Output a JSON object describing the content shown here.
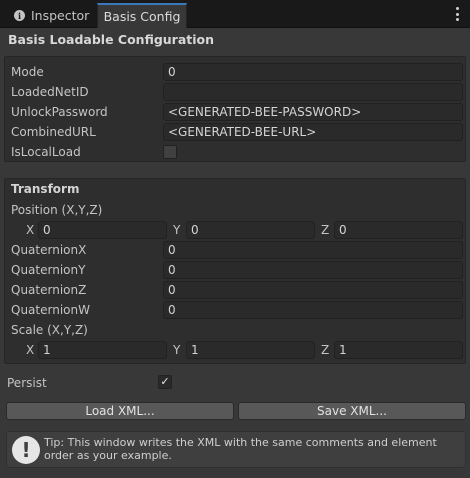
{
  "tabs": [
    {
      "label": "Inspector"
    },
    {
      "label": "Basis Config"
    }
  ],
  "header": {
    "title": "Basis Loadable Configuration"
  },
  "fields": {
    "mode": {
      "label": "Mode",
      "value": "0"
    },
    "loaded_net_id": {
      "label": "LoadedNetID",
      "value": ""
    },
    "unlock_password": {
      "label": "UnlockPassword",
      "value": "<GENERATED-BEE-PASSWORD>"
    },
    "combined_url": {
      "label": "CombinedURL",
      "value": "<GENERATED-BEE-URL>"
    },
    "is_local_load": {
      "label": "IsLocalLoad",
      "checked": false
    }
  },
  "transform": {
    "title": "Transform",
    "position": {
      "label": "Position (X,Y,Z)",
      "x": "0",
      "y": "0",
      "z": "0"
    },
    "quaternion": {
      "x": {
        "label": "QuaternionX",
        "value": "0"
      },
      "y": {
        "label": "QuaternionY",
        "value": "0"
      },
      "z": {
        "label": "QuaternionZ",
        "value": "0"
      },
      "w": {
        "label": "QuaternionW",
        "value": "0"
      }
    },
    "scale": {
      "label": "Scale (X,Y,Z)",
      "x": "1",
      "y": "1",
      "z": "1"
    },
    "axis_labels": {
      "x": "X",
      "y": "Y",
      "z": "Z"
    }
  },
  "persist": {
    "label": "Persist",
    "checked": true,
    "check_glyph": "✓"
  },
  "buttons": {
    "load": "Load XML...",
    "save": "Save XML..."
  },
  "help": {
    "icon": "!",
    "text": "Tip: This window writes the XML with the same comments and element order as your example."
  }
}
